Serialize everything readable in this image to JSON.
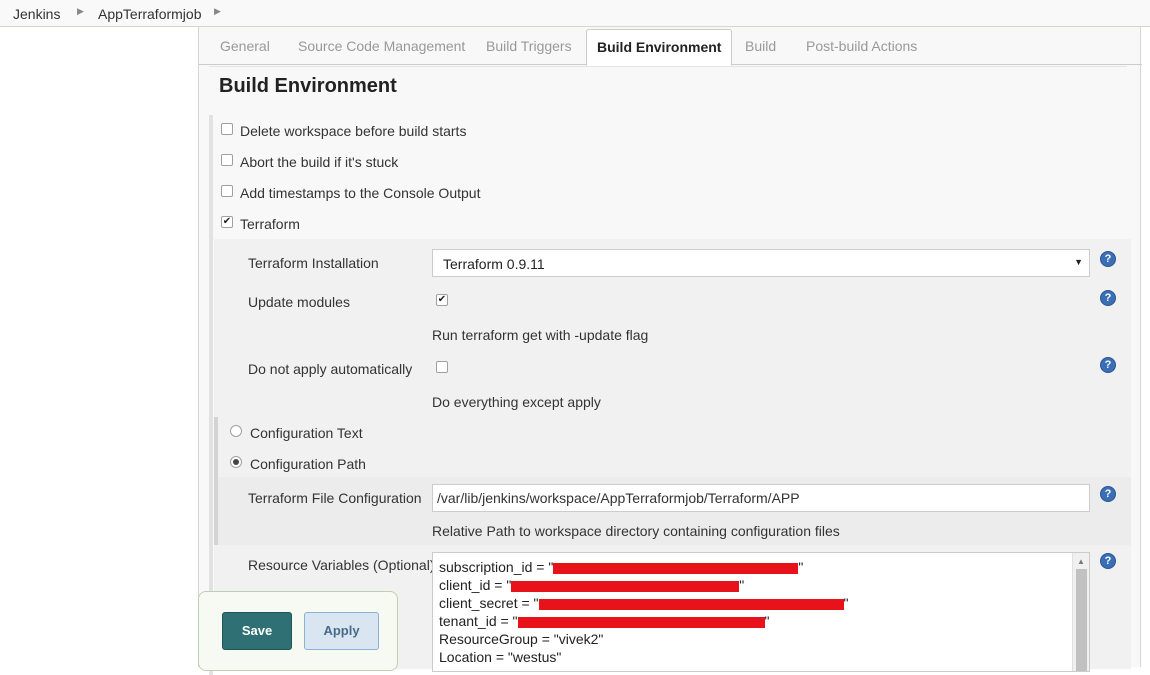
{
  "breadcrumb": {
    "items": [
      "Jenkins",
      "AppTerraformjob"
    ]
  },
  "tabs": [
    "General",
    "Source Code Management",
    "Build Triggers",
    "Build Environment",
    "Build",
    "Post-build Actions"
  ],
  "active_tab": "Build Environment",
  "section": {
    "title": "Build Environment"
  },
  "options": {
    "delete_workspace": {
      "label": "Delete workspace before build starts",
      "checked": false
    },
    "abort_stuck": {
      "label": "Abort the build if it's stuck",
      "checked": false
    },
    "timestamps": {
      "label": "Add timestamps to the Console Output",
      "checked": false
    },
    "terraform": {
      "label": "Terraform",
      "checked": true
    }
  },
  "terraform": {
    "installation_label": "Terraform Installation",
    "installation_value": "Terraform 0.9.11",
    "update_modules_label": "Update modules",
    "update_modules_checked": true,
    "update_modules_desc": "Run terraform get with -update flag",
    "no_apply_label": "Do not apply automatically",
    "no_apply_checked": false,
    "no_apply_desc": "Do everything except apply",
    "config_text_label": "Configuration Text",
    "config_path_label": "Configuration Path",
    "selected_config": "Configuration Path",
    "file_config_label": "Terraform File Configuration",
    "file_config_value": "/var/lib/jenkins/workspace/AppTerraformjob/Terraform/APP",
    "file_config_desc": "Relative Path to workspace directory containing configuration files",
    "resource_vars_label": "Resource Variables (Optional)",
    "resource_vars": {
      "line1_prefix": "subscription_id = \"",
      "line2_prefix": "client_id = \"",
      "line3_prefix": "client_secret = \"",
      "line4_prefix": "tenant_id = \"",
      "quote": "\"",
      "line5": "ResourceGroup = \"vivek2\"",
      "line6": "Location = \"westus\""
    }
  },
  "buttons": {
    "save": "Save",
    "apply": "Apply"
  },
  "icons": {
    "help": "?",
    "checkmark": "✔",
    "dropdown": "▼",
    "breadcrumb_arrow": "▶",
    "scroll_up": "▲"
  },
  "colors": {
    "save_button": "#2e7074",
    "apply_button": "#d9e6f2",
    "help_icon": "#3a6fb5",
    "redaction": "#e8131a"
  }
}
